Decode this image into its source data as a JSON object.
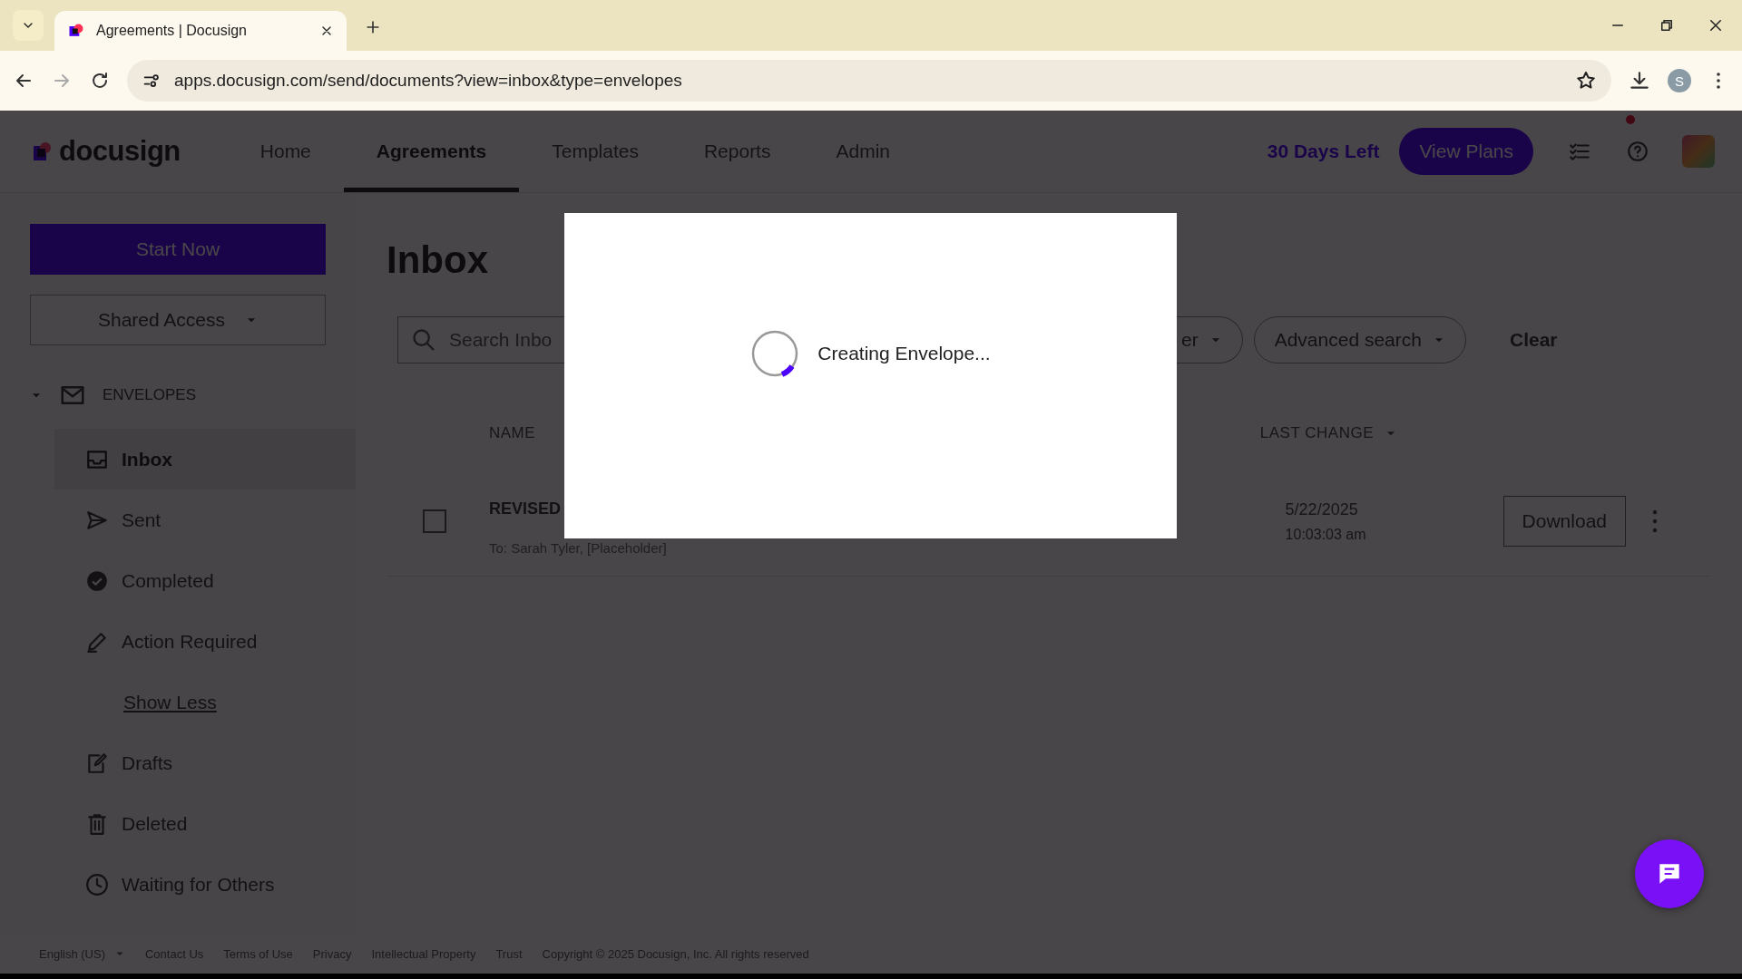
{
  "browser": {
    "tabs": [
      {
        "title": "Agreements | Docusign",
        "selected": true
      }
    ],
    "address": "apps.docusign.com/send/documents?view=inbox&type=envelopes",
    "profile_initial": "S"
  },
  "header": {
    "logo": "docusign",
    "nav": [
      {
        "label": "Home",
        "selected": false
      },
      {
        "label": "Agreements",
        "selected": true
      },
      {
        "label": "Templates",
        "selected": false
      },
      {
        "label": "Reports",
        "selected": false
      },
      {
        "label": "Admin",
        "selected": false
      }
    ],
    "trial": "30 Days Left",
    "plans_button": "View Plans",
    "notification_dot": true
  },
  "sidebar": {
    "start_button": "Start Now",
    "shared_access": "Shared Access",
    "section": {
      "label": "ENVELOPES",
      "expanded": true
    },
    "items": [
      {
        "label": "Inbox",
        "kind": "folder",
        "selected": true
      },
      {
        "label": "Sent",
        "kind": "folder",
        "selected": false
      },
      {
        "label": "Completed",
        "kind": "folder",
        "selected": false
      },
      {
        "label": "Action Required",
        "kind": "folder",
        "selected": false
      },
      {
        "label": "Show Less",
        "kind": "link",
        "selected": false
      },
      {
        "label": "Drafts",
        "kind": "folder",
        "selected": false
      },
      {
        "label": "Deleted",
        "kind": "folder",
        "selected": false
      },
      {
        "label": "Waiting for Others",
        "kind": "folder",
        "selected": false
      }
    ]
  },
  "main": {
    "title": "Inbox",
    "search": {
      "placeholder": "Search Inbo"
    },
    "filters": [
      "er",
      "Advanced search"
    ],
    "clear": "Clear",
    "columns": [
      "NAME",
      "LAST CHANGE"
    ],
    "rows": [
      {
        "checked": false,
        "name": "REVISED",
        "recipients": "To: Sarah Tyler, [Placeholder]",
        "date": "5/22/2025",
        "time": "10:03:03 am",
        "action": "Download"
      }
    ]
  },
  "modal": {
    "message": "Creating Envelope..."
  },
  "footer": {
    "language": "English (US)",
    "links": [
      "Contact Us",
      "Terms of Use",
      "Privacy",
      "Intellectual Property",
      "Trust"
    ],
    "copyright": "Copyright © 2025 Docusign, Inc. All rights reserved"
  }
}
